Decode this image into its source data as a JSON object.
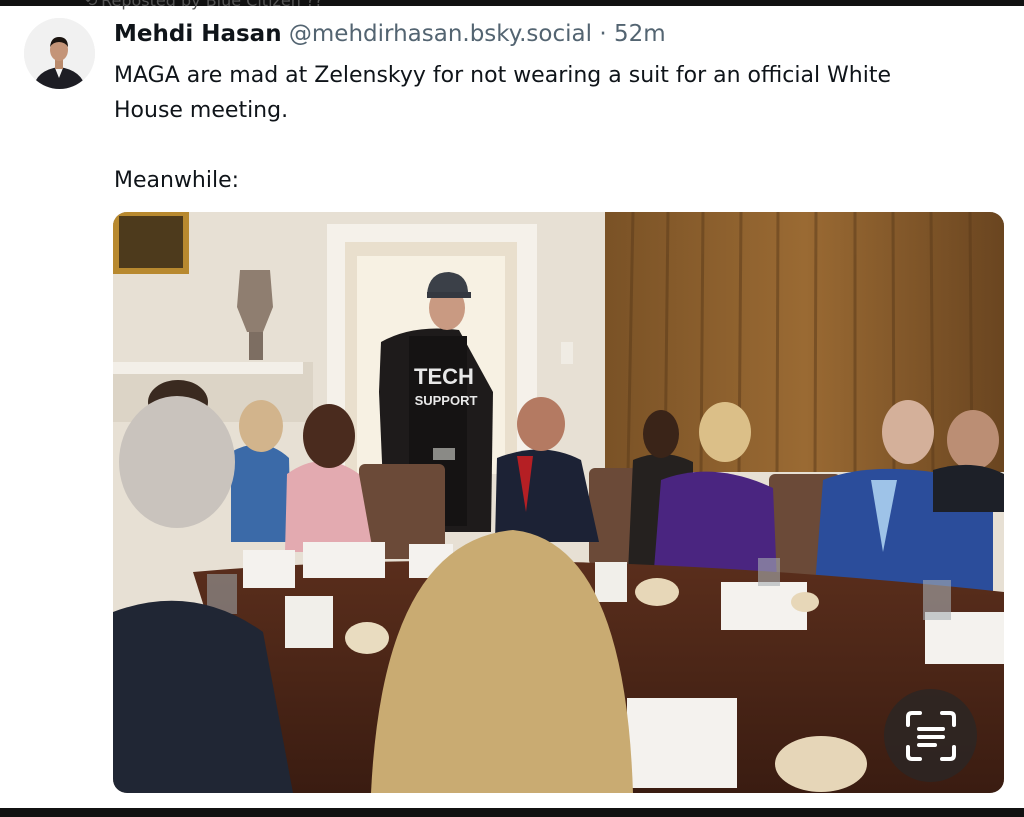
{
  "repost": {
    "text": "Reposted by Blue Citizen ??"
  },
  "post": {
    "author_name": "Mehdi Hasan",
    "handle": "@mehdirhasan.bsky.social",
    "separator": " · ",
    "time": "52m",
    "text_line1": "MAGA are mad at Zelenskyy for not wearing a suit for an official White",
    "text_line2": "House meeting.",
    "text_para2": "Meanwhile:"
  },
  "image": {
    "shirt_line1": "TECH",
    "shirt_line2": "SUPPORT"
  },
  "icons": {
    "avatar": "author-avatar",
    "lens": "image-text-scan-icon",
    "repost": "repost-icon"
  }
}
